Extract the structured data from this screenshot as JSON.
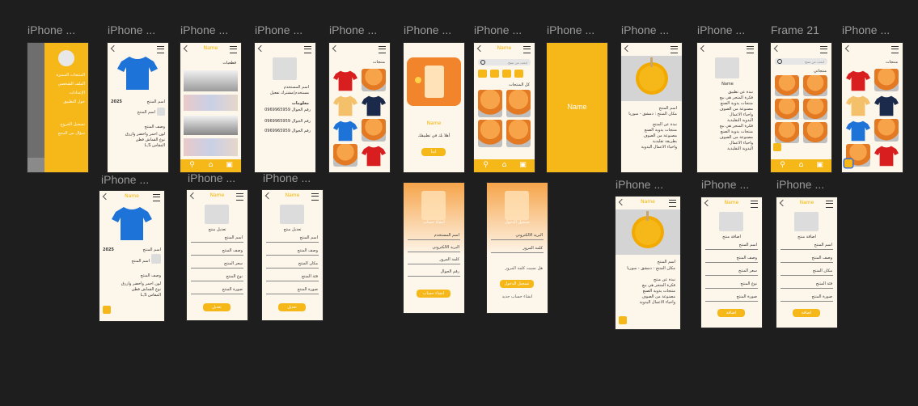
{
  "app": {
    "name": "Figma canvas"
  },
  "labels": {
    "iphone": "iPhone ...",
    "frame21": "Frame 21"
  },
  "common": {
    "brand": "Name",
    "brand_big": "Name"
  },
  "frames": {
    "menu": {
      "items": [
        "المنتجات المميزة",
        "الملف الشخصي",
        "الإعدادات",
        "حول التطبيق",
        "تسجيل الخروج",
        "سؤال من المنتج"
      ]
    },
    "product": {
      "price": "2025",
      "name_label": "اسم المنتج",
      "owner": "اسم المنتج",
      "desc_title": "وصف المنتج",
      "desc_lines": [
        "لون احمر واخضر وازرق",
        "نوع القماش قطن",
        "المقاس L,S"
      ]
    },
    "categories": {
      "title": "قطعيات"
    },
    "profile": {
      "line1": "اسم المستخدم",
      "line2": "مستخدم/مشترك تفعيل",
      "info_title": "معلومات",
      "phones": [
        "رقم الجوال 0969965959",
        "رقم الجوال 0969965959",
        "رقم الجوال 0969965959"
      ]
    },
    "grid": {
      "title": "منتجات"
    },
    "splash": {
      "caption": "أهلا بك في تطبيقك",
      "btn": "ابدأ"
    },
    "home": {
      "search_ph": "ابحث عن منتج",
      "section": "كل المنتجات"
    },
    "toy": {
      "title": "اسم المنتج",
      "place": "مكان المنتج : دمشق - سوريا",
      "about": "نبذة عن المنتج",
      "lines": [
        "منتجات يدوية الصنع",
        "مصنوعة من الصوف",
        "بطريقة تقليدية",
        "واحياء الاعمال اليدوية"
      ]
    },
    "about": {
      "brand": "Name",
      "title": "نبذة عن تطبيق",
      "lines": [
        "فكرة المتجر هي بيع",
        "منتجات يدوية الصنع",
        "مصنوعة من الصوف",
        "واحياء الاعمال",
        "اليدوية التقليدية",
        "فكرة المتجر هي بيع",
        "منتجات يدوية الصنع",
        "مصنوعة من الصوف",
        "واحياء الاعمال",
        "اليدوية التقليدية"
      ]
    },
    "frame21": {
      "search_ph": "ابحث عن منتج",
      "section": "منتجاتي"
    },
    "grid2": {
      "title": "منتجات"
    },
    "edit_product": {
      "title": "تعديل منتج",
      "fields": [
        "اسم المنتج",
        "وصف المنتج",
        "سعر المنتج",
        "نوع المنتج",
        "صورة المنتج"
      ],
      "btn": "تعديل"
    },
    "edit_product2": {
      "title": "تعديل منتج",
      "fields": [
        "اسم المنتج",
        "وصف المنتج",
        "مكان المنتج",
        "فئة المنتج",
        "صورة المنتج"
      ],
      "btn": "تعديل"
    },
    "register": {
      "title": "انشاء حساب",
      "fields": [
        "اسم المستخدم",
        "البريد الالكتروني",
        "كلمة المرور",
        "رقم الجوال"
      ],
      "btn": "انشاء حساب"
    },
    "login": {
      "title": "تسجيل الدخول",
      "fields": [
        "البريد الالكتروني",
        "كلمة المرور"
      ],
      "forgot": "هل نسيت كلمة المرور",
      "btn": "تسجيل الدخول",
      "alt": "انشاء حساب جديد"
    },
    "toy2": {
      "title": "اسم المنتج",
      "place": "مكان المنتج : دمشق - سوريا",
      "about": "نبذة عن منتج",
      "lines": [
        "فكرة المتجر هي بيع",
        "منتجات يدوية الصنع",
        "مصنوعة من الصوف",
        "واحياء الاعمال اليدوية"
      ]
    },
    "add_product": {
      "title": "اضافة منتج",
      "fields": [
        "اسم المنتج",
        "وصف المنتج",
        "سعر المنتج",
        "نوع المنتج",
        "صورة المنتج"
      ],
      "btn": "اضافة"
    },
    "add_product2": {
      "title": "اضافة منتج",
      "fields": [
        "اسم المنتج",
        "وصف المنتج",
        "مكان المنتج",
        "فئة المنتج",
        "صورة المنتج"
      ],
      "btn": "اضافة"
    }
  },
  "colors": {
    "accent": "#f6b818",
    "canvas": "#1e1e1e",
    "frame_bg": "#fdf6ea"
  }
}
